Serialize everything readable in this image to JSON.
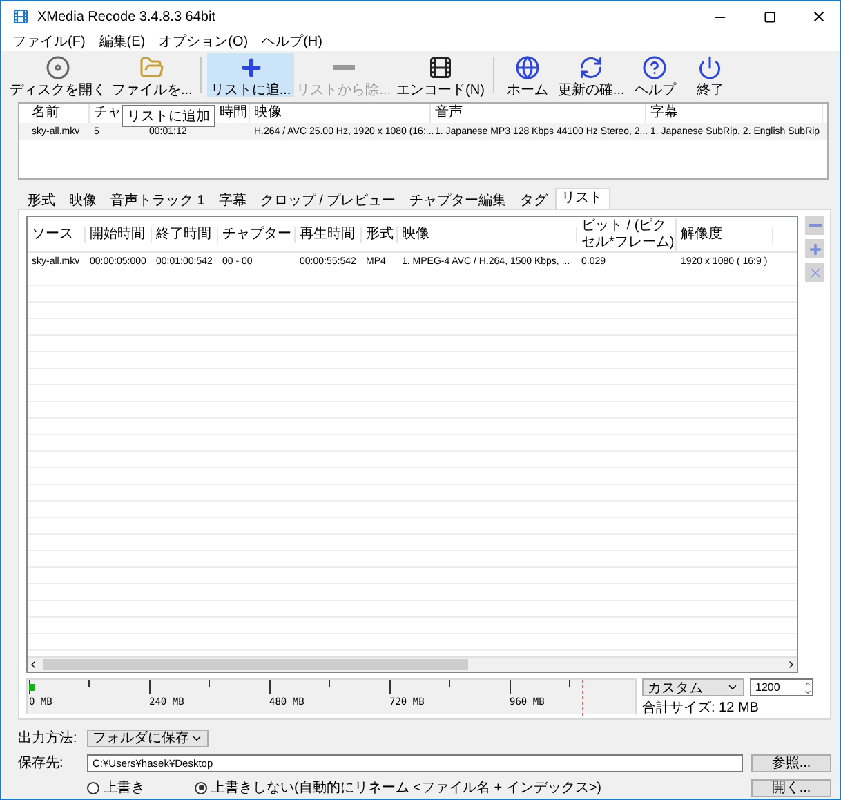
{
  "window": {
    "title": "XMedia Recode 3.4.8.3 64bit"
  },
  "menu": [
    "ファイル(F)",
    "編集(E)",
    "オプション(O)",
    "ヘルプ(H)"
  ],
  "toolbar": [
    {
      "label": "ディスクを開く",
      "highlighted": false,
      "disabled": false
    },
    {
      "label": "ファイルを...",
      "highlighted": false,
      "disabled": false
    },
    {
      "label": "リストに追...",
      "highlighted": true,
      "disabled": false
    },
    {
      "label": "リストから除...",
      "highlighted": false,
      "disabled": true
    },
    {
      "label": "エンコード(N)",
      "highlighted": false,
      "disabled": false
    },
    {
      "label": "ホーム",
      "highlighted": false,
      "disabled": false
    },
    {
      "label": "更新の確...",
      "highlighted": false,
      "disabled": false
    },
    {
      "label": "ヘルプ",
      "highlighted": false,
      "disabled": false
    },
    {
      "label": "終了",
      "highlighted": false,
      "disabled": false
    }
  ],
  "tooltip": "リストに追加",
  "file_list": {
    "columns": [
      "",
      "名前",
      "チャ",
      "時間",
      "映像",
      "音声",
      "字幕"
    ],
    "rows": [
      [
        "",
        "sky-all.mkv",
        "5",
        "00:01:12",
        "H.264 / AVC  25.00 Hz, 1920 x 1080 (16:...",
        "1. Japanese MP3 128 Kbps 44100 Hz Stereo, 2...",
        "1. Japanese SubRip, 2. English SubRip"
      ]
    ]
  },
  "tabs": [
    {
      "label": "形式",
      "selected": false
    },
    {
      "label": "映像",
      "selected": false
    },
    {
      "label": "音声トラック 1",
      "selected": false
    },
    {
      "label": "字幕",
      "selected": false
    },
    {
      "label": "クロップ / プレビュー",
      "selected": false
    },
    {
      "label": "チャプター編集",
      "selected": false
    },
    {
      "label": "タグ",
      "selected": false
    },
    {
      "label": "リスト",
      "selected": true
    }
  ],
  "job_list": {
    "columns": [
      "ソース",
      "開始時間",
      "終了時間",
      "チャプター",
      "再生時間",
      "形式",
      "映像",
      "ビット / (ピクセル*フレーム)",
      "解像度"
    ],
    "rows": [
      [
        "sky-all.mkv",
        "00:00:05:000",
        "00:01:00:542",
        "00 - 00",
        "00:00:55:542",
        "MP4",
        "1. MPEG-4 AVC / H.264, 1500 Kbps, ...",
        "0.029",
        "1920 x 1080 ( 16:9 )"
      ]
    ]
  },
  "size_bar": {
    "ticks": [
      "0 MB",
      "240 MB",
      "480 MB",
      "720 MB",
      "960 MB"
    ],
    "level": 0.01
  },
  "size_preset": {
    "value": "カスタム"
  },
  "size_value": {
    "value": "1200"
  },
  "total_size": "合計サイズ: 12 MB",
  "output_method": {
    "label": "出力方法:",
    "value": "フォルダに保存"
  },
  "save_to": {
    "label": "保存先:",
    "value": "C:¥Users¥hasek¥Desktop",
    "browse": "参照...",
    "open": "開く..."
  },
  "overwrite": [
    {
      "label": "上書き",
      "selected": false
    },
    {
      "label": "上書きしない(自動的にリネーム <ファイル名 + インデックス>)",
      "selected": true
    }
  ]
}
